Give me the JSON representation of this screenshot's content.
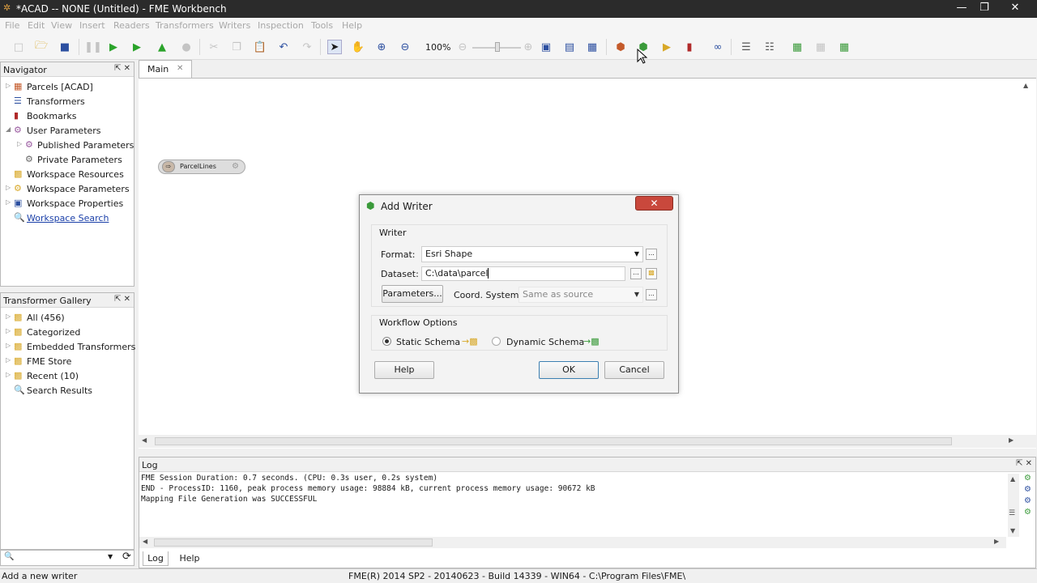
{
  "window": {
    "title": "*ACAD -- NONE (Untitled) - FME Workbench"
  },
  "menu": [
    "File",
    "Edit",
    "View",
    "Insert",
    "Readers",
    "Transformers",
    "Writers",
    "Inspection",
    "Tools",
    "Help"
  ],
  "toolbar": {
    "zoom": "100%"
  },
  "tabs": {
    "main": "Main"
  },
  "navigator": {
    "title": "Navigator",
    "items": [
      {
        "label": "Parcels [ACAD]",
        "icon": "reader-icon"
      },
      {
        "label": "Transformers",
        "icon": "transformer-icon"
      },
      {
        "label": "Bookmarks",
        "icon": "bookmark-icon"
      },
      {
        "label": "User Parameters",
        "icon": "gear-icon"
      },
      {
        "label": "Published Parameters",
        "icon": "gear-icon"
      },
      {
        "label": "Private Parameters",
        "icon": "gear-icon"
      },
      {
        "label": "Workspace Resources",
        "icon": "folder-icon"
      },
      {
        "label": "Workspace Parameters",
        "icon": "gear-icon"
      },
      {
        "label": "Workspace Properties",
        "icon": "properties-icon"
      },
      {
        "label": "Workspace Search",
        "icon": "search-icon"
      }
    ]
  },
  "gallery": {
    "title": "Transformer Gallery",
    "items": [
      {
        "label": "All (456)"
      },
      {
        "label": "Categorized"
      },
      {
        "label": "Embedded Transformers"
      },
      {
        "label": "FME Store"
      },
      {
        "label": "Recent (10)"
      },
      {
        "label": "Search Results"
      }
    ]
  },
  "canvas": {
    "feature_type": "ParcelLines"
  },
  "dialog": {
    "title": "Add Writer",
    "writer_group": "Writer",
    "format_label": "Format:",
    "format_value": "Esri Shape",
    "dataset_label": "Dataset:",
    "dataset_value": "C:\\data\\parcel",
    "parameters_button": "Parameters...",
    "coord_label": "Coord. System:",
    "coord_value": "Same as source",
    "workflow_group": "Workflow Options",
    "static_schema": "Static Schema",
    "dynamic_schema": "Dynamic Schema",
    "help_button": "Help",
    "ok_button": "OK",
    "cancel_button": "Cancel"
  },
  "log": {
    "title": "Log",
    "lines": [
      "FME Session Duration: 0.7 seconds. (CPU: 0.3s user, 0.2s system)",
      "END - ProcessID: 1160, peak process memory usage: 98884 kB, current process memory usage: 90672 kB",
      "Mapping File Generation was SUCCESSFUL"
    ],
    "tab_log": "Log",
    "tab_help": "Help"
  },
  "status": {
    "left": "Add a new writer",
    "center": "FME(R) 2014 SP2 - 20140623 - Build 14339 - WIN64 - C:\\Program Files\\FME\\"
  },
  "colors": {
    "titlebar": "#2b2b2b",
    "close_red": "#c9483c",
    "link_blue": "#1a3fa8"
  }
}
